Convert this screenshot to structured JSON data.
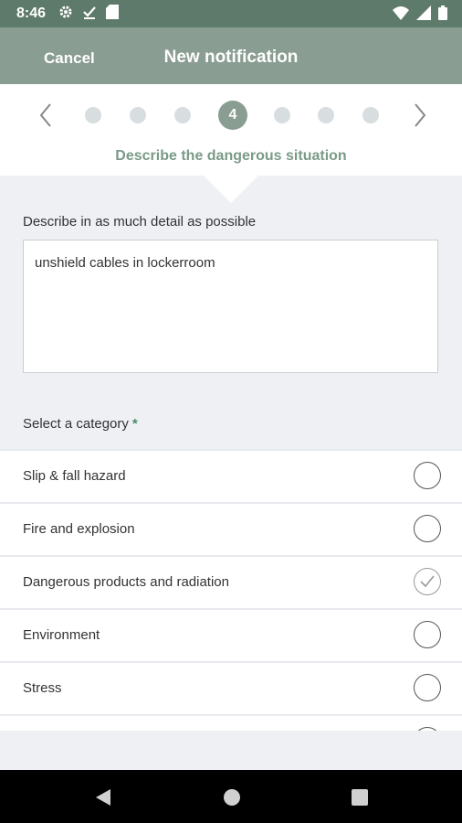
{
  "status_bar": {
    "time": "8:46",
    "left_icons": [
      "gear-icon",
      "download-check-icon",
      "sd-card-icon"
    ],
    "right_icons": [
      "wifi-icon",
      "signal-icon",
      "battery-icon"
    ]
  },
  "app_bar": {
    "cancel_label": "Cancel",
    "title": "New notification"
  },
  "stepper": {
    "current_step": "4",
    "subtitle": "Describe the dangerous situation"
  },
  "description": {
    "label": "Describe in as much detail as possible",
    "value": "unshield cables in lockerroom"
  },
  "category": {
    "label": "Select a category",
    "required_mark": "*",
    "items": [
      {
        "label": "Slip & fall hazard",
        "checked": false
      },
      {
        "label": "Fire and explosion",
        "checked": false
      },
      {
        "label": "Dangerous products and radiation",
        "checked": true
      },
      {
        "label": "Environment",
        "checked": false
      },
      {
        "label": "Stress",
        "checked": false
      }
    ]
  },
  "colors": {
    "status_bar": "#5e7a6a",
    "app_bar": "#8a9d92",
    "accent_text": "#7a9a88",
    "background": "#eef0f4"
  }
}
